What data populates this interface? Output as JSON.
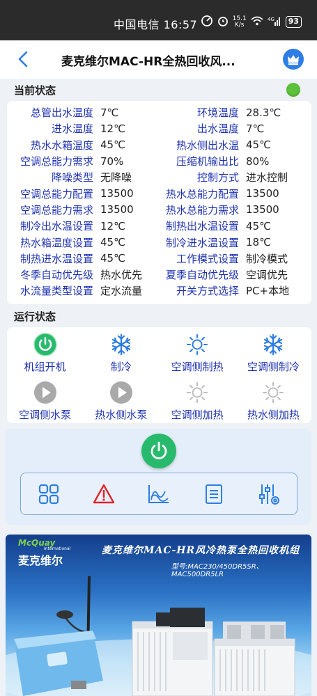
{
  "status_bar": {
    "carrier": "中国电信",
    "time": "16:57",
    "speed_value": "15.1",
    "speed_unit": "K/s",
    "network": "4G",
    "battery": "93"
  },
  "header": {
    "title": "麦克维尔MAC-HR全热回收风..."
  },
  "current_status": {
    "title": "当前状态",
    "rows": [
      {
        "l1": "总管出水温度",
        "v1": "7℃",
        "l2": "环境温度",
        "v2": "28.3℃"
      },
      {
        "l1": "进水温度",
        "v1": "12℃",
        "l2": "出水温度",
        "v2": "7℃"
      },
      {
        "l1": "热水水箱温度",
        "v1": "45℃",
        "l2": "热水侧出水温",
        "v2": "45℃"
      },
      {
        "l1": "空调总能力需求",
        "v1": "70%",
        "l2": "压缩机输出比",
        "v2": "80%"
      },
      {
        "l1": "降噪类型",
        "v1": "无降噪",
        "l2": "控制方式",
        "v2": "进水控制"
      },
      {
        "l1": "空调总能力配置",
        "v1": "13500",
        "l2": "热水总能力配置",
        "v2": "13500"
      },
      {
        "l1": "空调总能力需求",
        "v1": "13500",
        "l2": "热水总能力需求",
        "v2": "13500"
      },
      {
        "l1": "制冷出水温设置",
        "v1": "12℃",
        "l2": "制热出水温设置",
        "v2": "45℃"
      },
      {
        "l1": "热水箱温度设置",
        "v1": "45℃",
        "l2": "制冷进水温设置",
        "v2": "18℃"
      },
      {
        "l1": "制热进水温设置",
        "v1": "45℃",
        "l2": "工作模式设置",
        "v2": "制冷模式"
      },
      {
        "l1": "冬季自动优先级",
        "v1": "热水优先",
        "l2": "夏季自动优先级",
        "v2": "空调优先"
      },
      {
        "l1": "水流量类型设置",
        "v1": "定水流量",
        "l2": "开关方式选择",
        "v2": "PC+本地"
      }
    ]
  },
  "run_status": {
    "title": "运行状态",
    "items": [
      {
        "label": "机组开机",
        "icon": "power-on-icon"
      },
      {
        "label": "制冷",
        "icon": "snowflake-icon"
      },
      {
        "label": "空调侧制热",
        "icon": "sun-icon"
      },
      {
        "label": "空调侧制冷",
        "icon": "snowflake-icon"
      },
      {
        "label": "空调侧水泵",
        "icon": "pump-icon"
      },
      {
        "label": "热水侧水泵",
        "icon": "pump-icon"
      },
      {
        "label": "空调侧加热",
        "icon": "sun-gray-icon"
      },
      {
        "label": "热水侧加热",
        "icon": "sun-gray-icon"
      }
    ]
  },
  "toolbar": {
    "icons": [
      "grid-icon",
      "alarm-icon",
      "trend-chart-icon",
      "list-icon",
      "settings-sliders-icon"
    ]
  },
  "banner": {
    "brand_en": "McQuay",
    "brand_en_sub": "International",
    "brand_cn": "麦克维尔",
    "title": "麦克维尔MAC-HR风冷热泵全热回收机组",
    "model": "型号:MAC230/450DR5SR、MAC500DR5LR"
  },
  "colors": {
    "label_blue": "#1f33b3",
    "power_green": "#27ba6c",
    "status_green": "#5cc23a",
    "accent_blue": "#2d7de4",
    "alarm_red": "#e0252b"
  }
}
